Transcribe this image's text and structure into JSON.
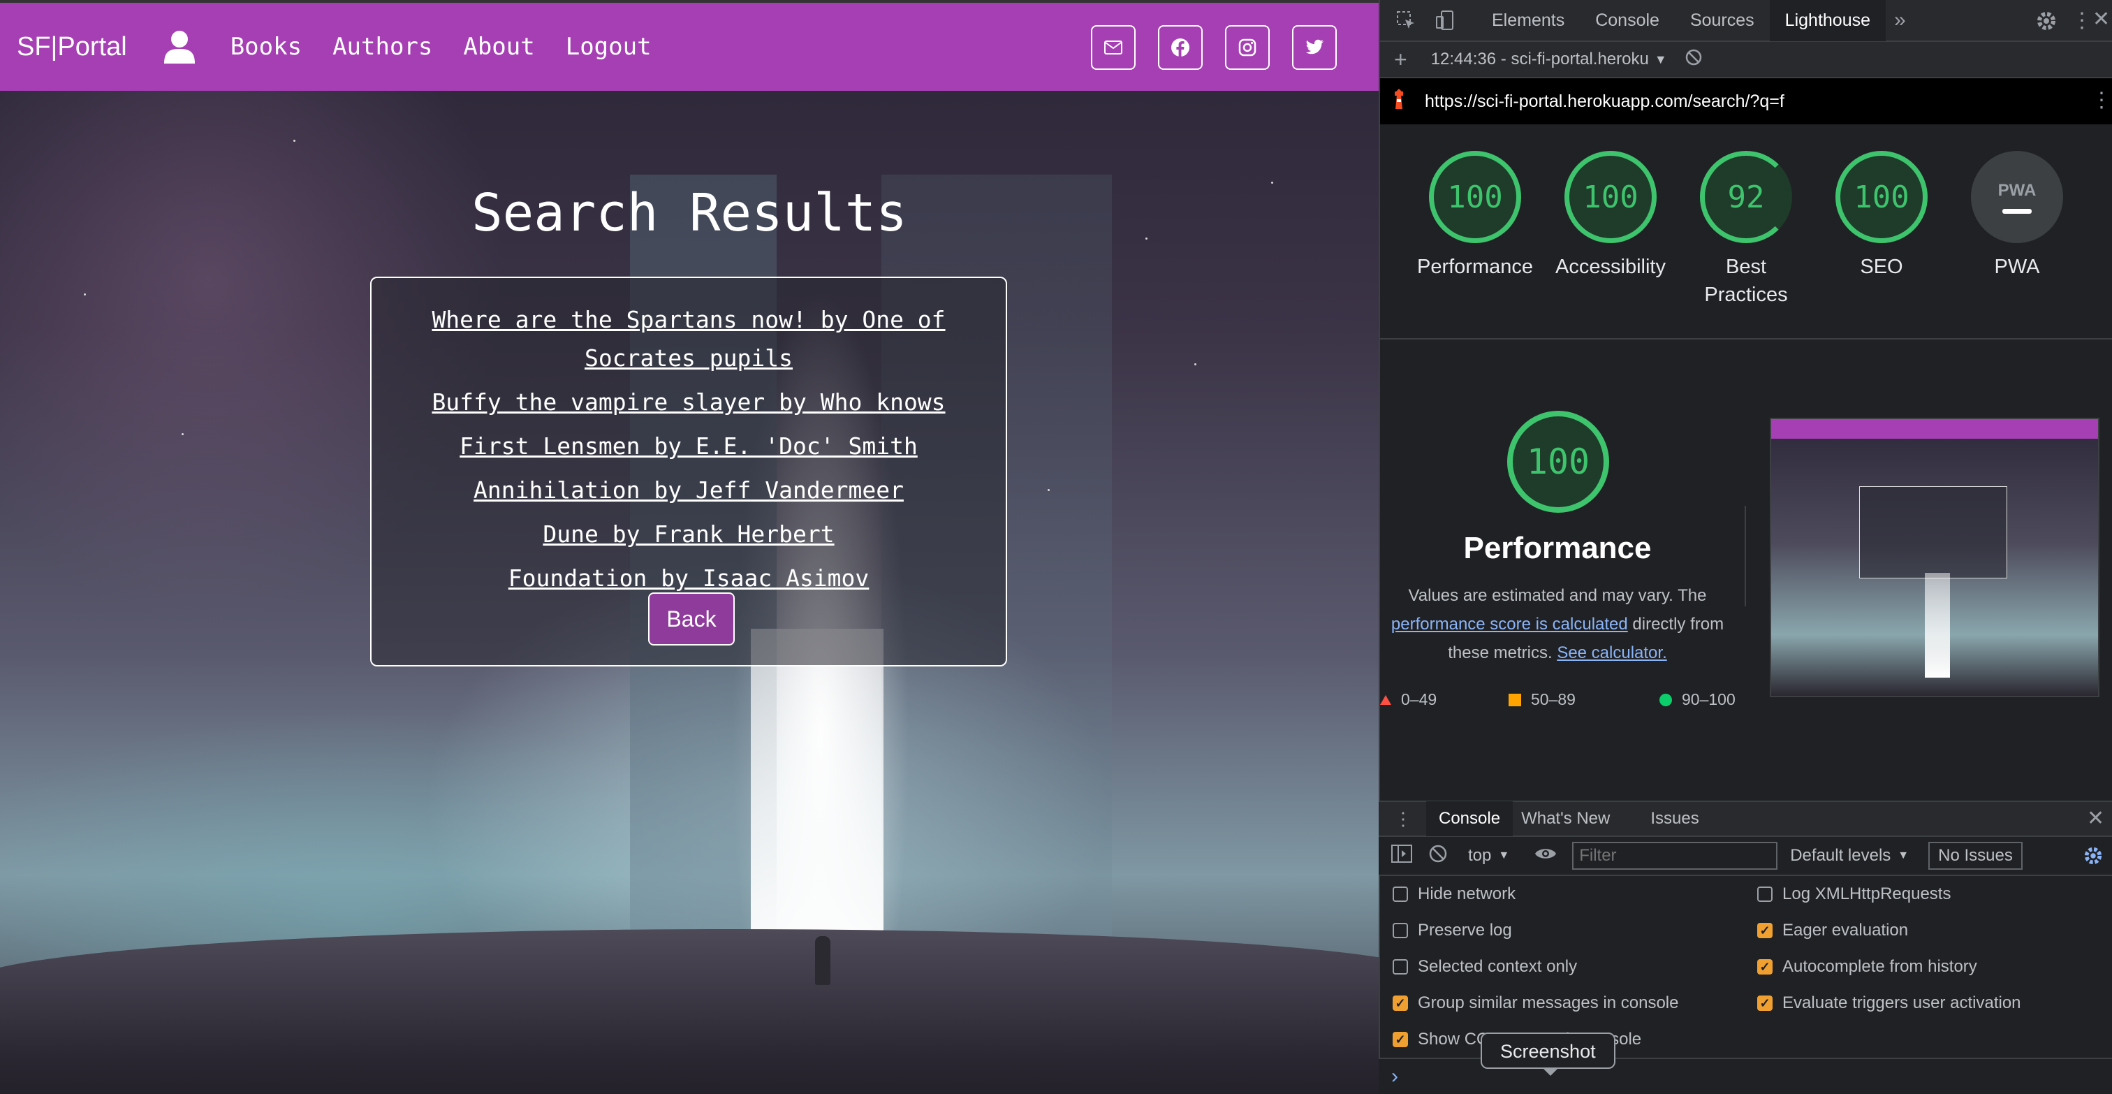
{
  "site": {
    "brand": "SF|Portal",
    "nav": [
      {
        "label": "Books"
      },
      {
        "label": "Authors"
      },
      {
        "label": "About"
      },
      {
        "label": "Logout"
      }
    ],
    "social_icons": [
      "email-icon",
      "facebook-icon",
      "instagram-icon",
      "twitter-icon"
    ],
    "page_title": "Search Results",
    "results": [
      "Where are the Spartans now! by One of Socrates pupils",
      "Buffy the vampire slayer by Who knows",
      "First Lensmen by E.E. 'Doc' Smith",
      "Annihilation by Jeff Vandermeer",
      "Dune by Frank Herbert",
      "Foundation by Isaac Asimov"
    ],
    "back_label": "Back",
    "colors": {
      "navbar": "#a63fb4",
      "button": "#8e3b9b"
    }
  },
  "devtools": {
    "tabs": [
      "Elements",
      "Console",
      "Sources",
      "Lighthouse"
    ],
    "active_tab": "Lighthouse",
    "report_label": "12:44:36 - sci-fi-portal.heroku",
    "url": "https://sci-fi-portal.herokuapp.com/search/?q=f",
    "scores": [
      {
        "label": "Performance",
        "value": "100"
      },
      {
        "label": "Accessibility",
        "value": "100"
      },
      {
        "label": "Best Practices",
        "value": "92"
      },
      {
        "label": "SEO",
        "value": "100"
      },
      {
        "label": "PWA",
        "value": "PWA"
      }
    ],
    "performance": {
      "score": "100",
      "title": "Performance",
      "desc_start": "Values are estimated and may vary. The",
      "desc_link": "performance score is calculated",
      "desc_mid": "directly from these metrics.",
      "calc_link": "See calculator."
    },
    "legend": [
      {
        "range": "0–49",
        "color": "#ff4e42"
      },
      {
        "range": "50–89",
        "color": "#ffa400"
      },
      {
        "range": "90–100",
        "color": "#0cce6b"
      }
    ],
    "drawer_tabs": [
      "Console",
      "What's New",
      "Issues"
    ],
    "console_toolbar": {
      "context": "top",
      "filter_placeholder": "Filter",
      "levels": "Default levels",
      "issues": "No Issues"
    },
    "settings_left": [
      {
        "label": "Hide network",
        "checked": false
      },
      {
        "label": "Preserve log",
        "checked": false
      },
      {
        "label": "Selected context only",
        "checked": false
      },
      {
        "label": "Group similar messages in console",
        "checked": true
      },
      {
        "label": "Show CORS errors in console",
        "checked": true
      }
    ],
    "settings_right": [
      {
        "label": "Log XMLHttpRequests",
        "checked": false
      },
      {
        "label": "Eager evaluation",
        "checked": true
      },
      {
        "label": "Autocomplete from history",
        "checked": true
      },
      {
        "label": "Evaluate triggers user activation",
        "checked": true
      }
    ],
    "tooltip": "Screenshot",
    "prompt": "›"
  }
}
